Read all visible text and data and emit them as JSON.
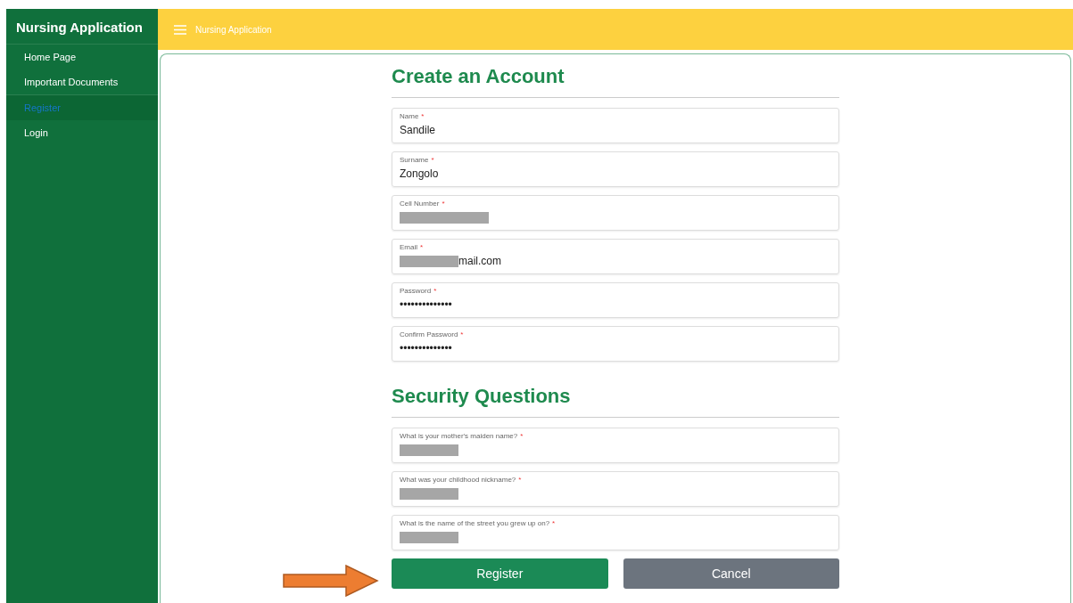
{
  "sidebar": {
    "title": "Nursing Application",
    "items": [
      {
        "label": "Home Page",
        "selected": false
      },
      {
        "label": "Important Documents",
        "selected": false
      },
      {
        "label": "Register",
        "selected": true
      },
      {
        "label": "Login",
        "selected": false
      }
    ]
  },
  "header": {
    "title": "Nursing Application"
  },
  "sections": [
    {
      "heading": "Create an Account",
      "fields": [
        {
          "label": "Name",
          "required_mark": "*",
          "value": "Sandile",
          "redacted": false
        },
        {
          "label": "Surname",
          "required_mark": "*",
          "value": "Zongolo",
          "redacted": false
        },
        {
          "label": "Cell Number",
          "required_mark": "*",
          "redacted": true
        },
        {
          "label": "Email",
          "required_mark": "*",
          "value": "mail.com",
          "redacted": true
        },
        {
          "label": "Password",
          "required_mark": "*",
          "value": "••••••••••••••",
          "redacted": false
        },
        {
          "label": "Confirm Password",
          "required_mark": "*",
          "value": "••••••••••••••",
          "redacted": false
        }
      ]
    },
    {
      "heading": "Security Questions",
      "fields": [
        {
          "label": "What is your mother's maiden name?",
          "required_mark": "*",
          "redacted": true
        },
        {
          "label": "What was your childhood nickname?",
          "required_mark": "*",
          "redacted": true
        },
        {
          "label": "What is the name of the street you grew up on?",
          "required_mark": "*",
          "redacted": true
        }
      ]
    }
  ],
  "buttons": [
    {
      "label": "Register",
      "kind": "primary"
    },
    {
      "label": "Cancel",
      "kind": "secondary"
    }
  ]
}
